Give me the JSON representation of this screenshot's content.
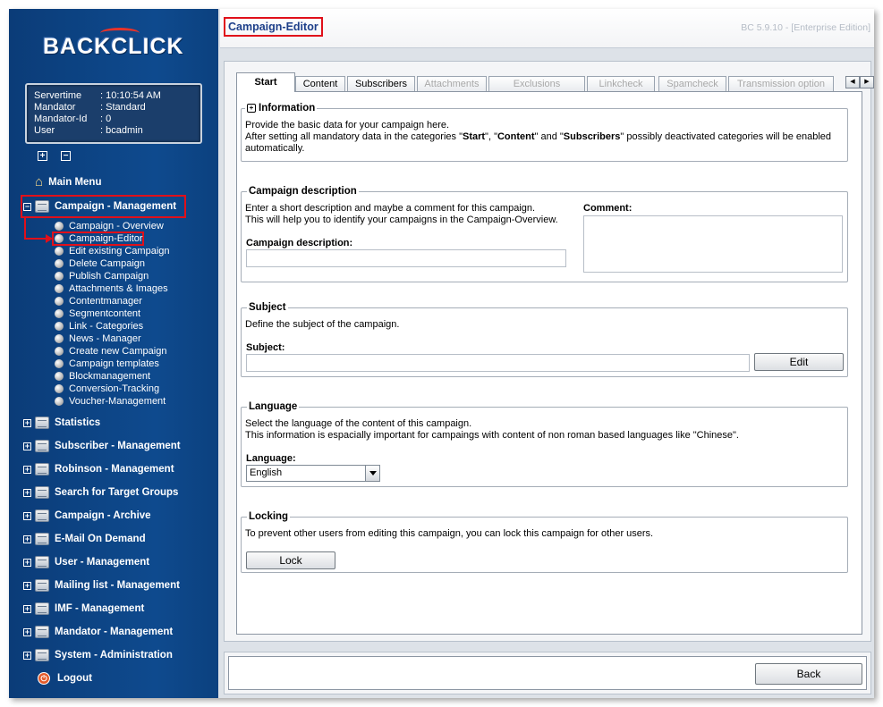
{
  "sidebar": {
    "logo": "BACKCLICK",
    "info": [
      {
        "key": "Servertime",
        "value": ": 10:10:54 AM"
      },
      {
        "key": "Mandator",
        "value": ": Standard"
      },
      {
        "key": "Mandator-Id",
        "value": ": 0"
      },
      {
        "key": "User",
        "value": ": bcadmin"
      }
    ],
    "expand_all": "+",
    "collapse_all": "−",
    "main_menu": "Main Menu",
    "campaign_management": "Campaign - Management",
    "campaign_items": [
      "Campaign - Overview",
      "Campaign-Editor",
      "Edit existing Campaign",
      "Delete Campaign",
      "Publish Campaign",
      "Attachments & Images",
      "Contentmanager",
      "Segmentcontent",
      "Link - Categories",
      "News - Manager",
      "Create new Campaign",
      "Campaign templates",
      "Blockmanagement",
      "Conversion-Tracking",
      "Voucher-Management"
    ],
    "sections": [
      "Statistics",
      "Subscriber - Management",
      "Robinson - Management",
      "Search for Target Groups",
      "Campaign - Archive",
      "E-Mail On Demand",
      "User - Management",
      "Mailing list - Management",
      "IMF - Management",
      "Mandator - Management",
      "System - Administration"
    ],
    "logout": "Logout"
  },
  "header": {
    "title": "Campaign-Editor",
    "version": "BC 5.9.10 - [Enterprise Edition]"
  },
  "tabs": [
    {
      "label": "Start",
      "state": "active"
    },
    {
      "label": "Content",
      "state": "enabled"
    },
    {
      "label": "Subscribers",
      "state": "enabled"
    },
    {
      "label": "Attachments",
      "state": "disabled"
    },
    {
      "label": "Exclusions",
      "state": "disabled"
    },
    {
      "label": "Linkcheck",
      "state": "disabled"
    },
    {
      "label": "Spamcheck",
      "state": "disabled"
    },
    {
      "label": "Transmission option",
      "state": "disabled"
    }
  ],
  "information": {
    "legend": "Information",
    "line1": "Provide the basic data for your campaign here.",
    "line2_a": "After setting all mandatory data in the categories \"",
    "start": "Start",
    "sep1": "\", \"",
    "content": "Content",
    "sep2": "\" and \"",
    "subscribers": "Subscribers",
    "line2_b": "\" possibly deactivated categories will be enabled",
    "line3": "automatically."
  },
  "campaign_description": {
    "legend": "Campaign description",
    "line1": "Enter a short description and maybe a comment for this campaign.",
    "line2": "This will help you to identify your campaigns in the Campaign-Overview.",
    "description_label": "Campaign description:",
    "description_value": "",
    "comment_label": "Comment:",
    "comment_value": ""
  },
  "subject": {
    "legend": "Subject",
    "line1": "Define the subject of the campaign.",
    "label": "Subject:",
    "value": "",
    "edit_button": "Edit"
  },
  "language": {
    "legend": "Language",
    "line1": "Select the language of the content of this campaign.",
    "line2": "This information is espacially important for campaings with content of non roman based languages like \"Chinese\".",
    "label": "Language:",
    "selected": "English"
  },
  "locking": {
    "legend": "Locking",
    "line1": "To prevent other users from editing this campaign, you can lock this campaign for other users.",
    "button": "Lock"
  },
  "footer": {
    "back_button": "Back"
  },
  "colors": {
    "sidebar_blue": "#0e4a8e",
    "highlight_red": "#e0101a",
    "title_blue": "#1d3f8a"
  }
}
